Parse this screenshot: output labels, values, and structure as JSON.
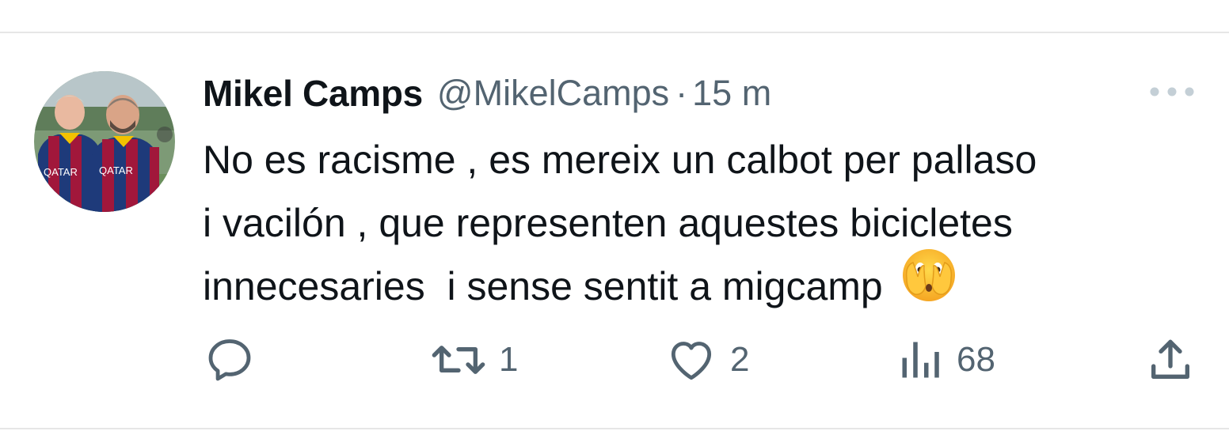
{
  "tweet": {
    "author_name": "Mikel Camps",
    "handle": "@MikelCamps",
    "separator": "·",
    "time": "15 m",
    "text_lines": [
      "No es racisme , es mereix un calbot per pallaso",
      "i vacilón , que representen aquestes bicicletes",
      "innecesaries  i sense sentit a migcamp"
    ],
    "emoji": "face-with-open-eyes-and-hand-over-mouth",
    "avatar": {
      "jersey_text_left": "QATAR",
      "jersey_text_right": "QATAR"
    }
  },
  "actions": {
    "reply_icon": "reply-icon",
    "retweet_icon": "retweet-icon",
    "retweet_count": "1",
    "like_icon": "heart-icon",
    "like_count": "2",
    "views_icon": "views-bar-chart-icon",
    "views_count": "68",
    "share_icon": "share-icon"
  },
  "colors": {
    "text_primary": "#0f1419",
    "text_secondary": "#536471",
    "divider": "#e6e6e6"
  }
}
